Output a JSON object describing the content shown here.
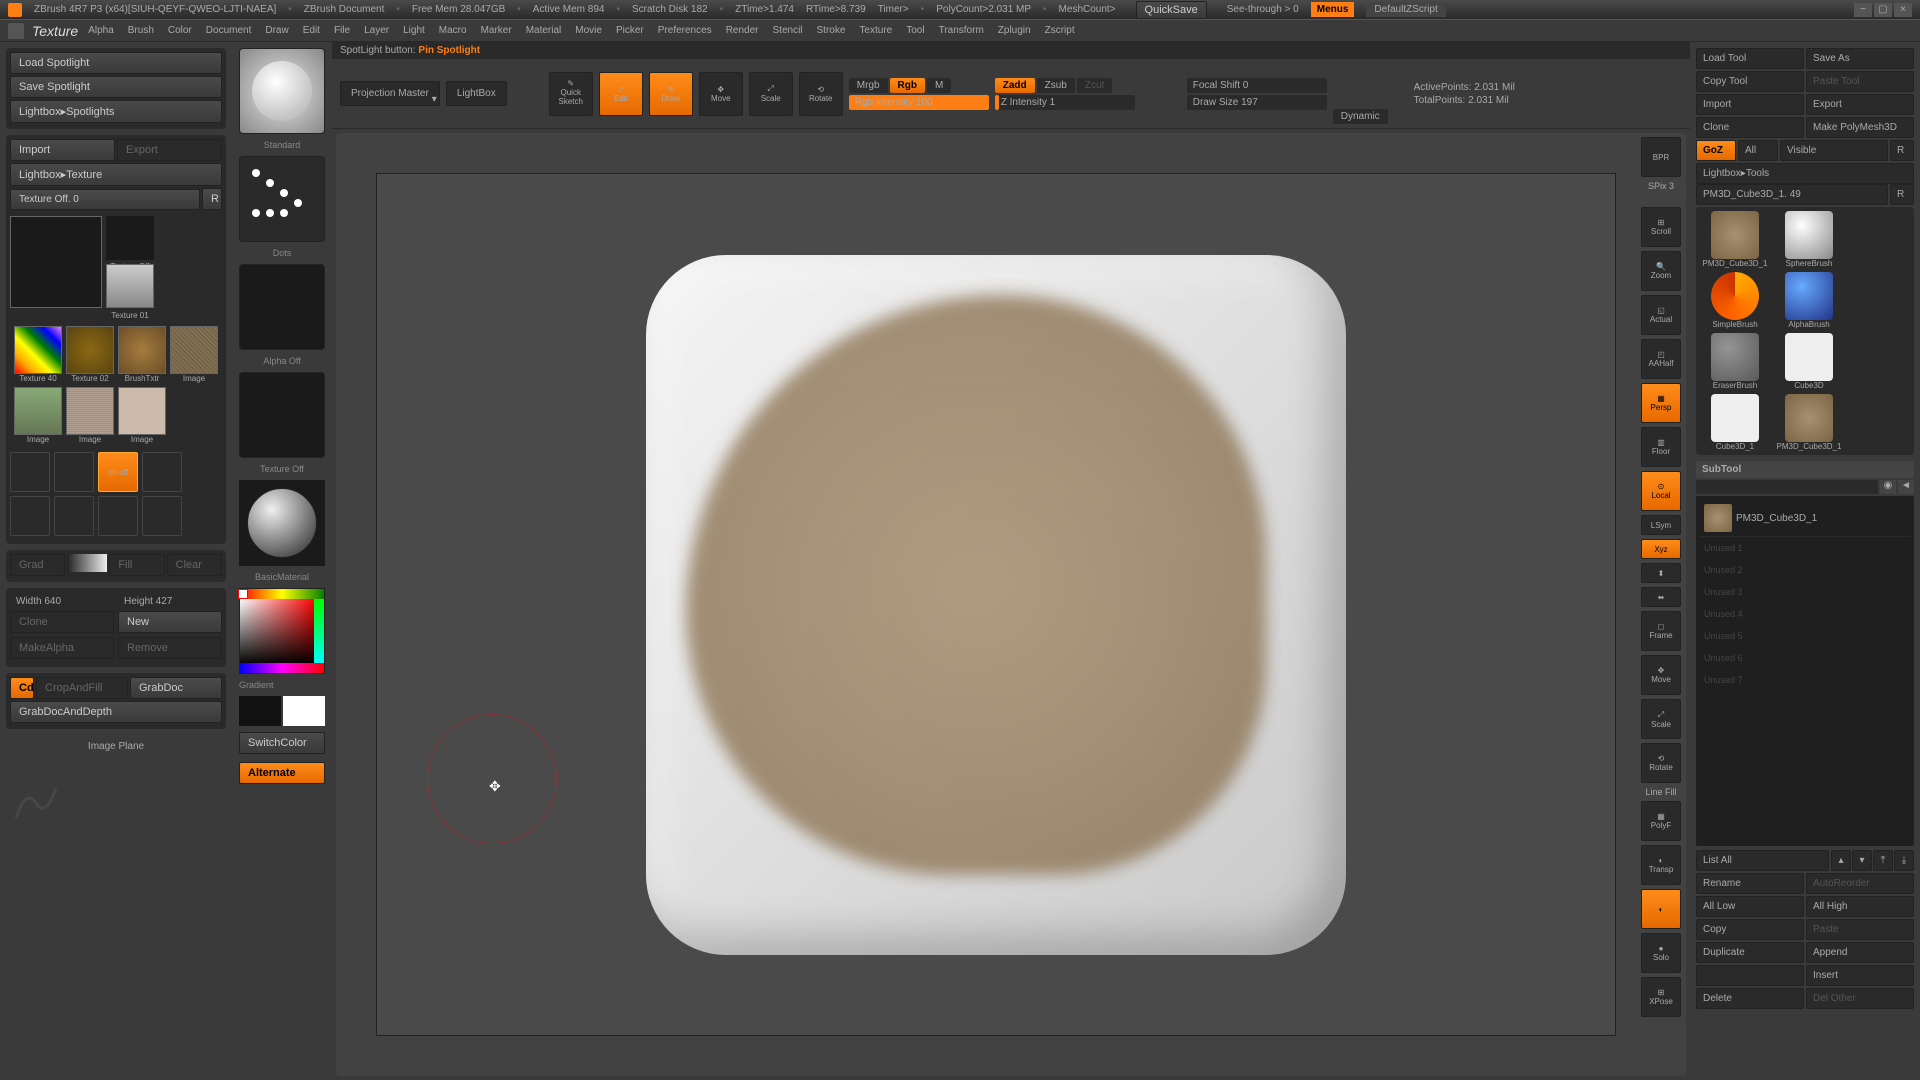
{
  "title_bar": {
    "app": "ZBrush 4R7 P3 (x64)[SIUH-QEYF-QWEO-LJTI-NAEA]",
    "doc": "ZBrush Document",
    "freemem": "Free Mem 28.047GB",
    "activemem": "Active Mem 894",
    "scratch": "Scratch Disk 182",
    "ztime": "ZTime>1.474",
    "rtime": "RTime>8.739",
    "timer": "Timer>",
    "polycount": "PolyCount>2.031 MP",
    "meshcount": "MeshCount>",
    "quicksave": "QuickSave",
    "seethrough": "See-through >  0",
    "menus": "Menus",
    "script": "DefaultZScript"
  },
  "menu": {
    "texture_label": "Texture",
    "items": [
      "Alpha",
      "Brush",
      "Color",
      "Document",
      "Draw",
      "Edit",
      "File",
      "Layer",
      "Light",
      "Macro",
      "Marker",
      "Material",
      "Movie",
      "Picker",
      "Preferences",
      "Render",
      "Stencil",
      "Stroke",
      "Texture",
      "Tool",
      "Transform",
      "Zplugin",
      "Zscript"
    ]
  },
  "caption": {
    "prefix": "SpotLight button:",
    "value": "Pin Spotlight"
  },
  "left": {
    "load_spotlight": "Load Spotlight",
    "save_spotlight": "Save Spotlight",
    "lightbox_spotlights": "Lightbox▸Spotlights",
    "import": "Import",
    "export": "Export",
    "lightbox_texture": "Lightbox▸Texture",
    "texture_off": "Texture Off. 0",
    "r": "R",
    "swatches": {
      "off": "Texture Off",
      "t01": "Texture 01",
      "rainbow": "Texture 40",
      "t02": "Texture 02",
      "brushtxtr": "BrushTxtr",
      "image": "Image",
      "image2": "Image",
      "image3": "Image",
      "image4": "Image"
    },
    "onoff": "on off",
    "grad": "Grad",
    "fill": "Fill",
    "clear": "Clear",
    "width": "Width 640",
    "height": "Height 427",
    "clone": "Clone",
    "new": "New",
    "makealpha": "MakeAlpha",
    "remove": "Remove",
    "cd": "Cd",
    "cropfill": "CropAndFill",
    "grabdoc": "GrabDoc",
    "grabdocdepth": "GrabDocAndDepth",
    "image_plane": "Image Plane"
  },
  "tool_col": {
    "standard": "Standard",
    "dots": "Dots",
    "alpha_off": "Alpha Off",
    "texture_off": "Texture Off",
    "basicmat": "BasicMaterial",
    "gradient": "Gradient",
    "switchcolor": "SwitchColor",
    "alternate": "Alternate"
  },
  "toolbar": {
    "projection": "Projection Master",
    "lightbox": "LightBox",
    "quicksketch": "Quick Sketch",
    "edit": "Edit",
    "draw": "Draw",
    "move": "Move",
    "scale": "Scale",
    "rotate": "Rotate",
    "mrgb": "Mrgb",
    "rgb": "Rgb",
    "m": "M",
    "rgb_intensity": "Rgb Intensity 100",
    "zadd": "Zadd",
    "zsub": "Zsub",
    "zcut": "Zcut",
    "z_intensity": "Z Intensity 1",
    "focal": "Focal Shift 0",
    "drawsize": "Draw Size 197",
    "dynamic": "Dynamic",
    "activepoints": "ActivePoints: 2.031 Mil",
    "totalpoints": "TotalPoints: 2.031 Mil"
  },
  "right_icons": [
    "BPR",
    "SPix 3",
    "Scroll",
    "Zoom",
    "Actual",
    "AAHalf",
    "Persp",
    "Floor",
    "Local",
    "LSym",
    "Xyz",
    "",
    "",
    "Frame",
    "Move",
    "Scale",
    "Rotate",
    "Line Fill",
    "PolyF",
    "Transp",
    "Ghost",
    "Solo",
    "XPose"
  ],
  "right": {
    "load_tool": "Load Tool",
    "save_as": "Save As",
    "copy_tool": "Copy Tool",
    "paste_tool": "Paste Tool",
    "import": "Import",
    "export": "Export",
    "clone": "Clone",
    "make_polymesh": "Make PolyMesh3D",
    "goz": "GoZ",
    "all": "All",
    "visible": "Visible",
    "r": "R",
    "lightbox_tools": "Lightbox▸Tools",
    "current_tool": "PM3D_Cube3D_1. 49",
    "tools": {
      "cube": "PM3D_Cube3D_1",
      "sphere": "SphereBrush",
      "simple": "SimpleBrush",
      "alpha": "AlphaBrush",
      "eraser": "EraserBrush",
      "cube1": "Cube3D",
      "cube2": "Cube3D_1",
      "cube3": "PM3D_Cube3D_1"
    },
    "subtool": "SubTool",
    "subtool_item": "PM3D_Cube3D_1",
    "unused": [
      "Unused 1",
      "Unused 2",
      "Unused 3",
      "Unused 4",
      "Unused 5",
      "Unused 6",
      "Unused 7"
    ],
    "list_all": "List All",
    "rename": "Rename",
    "autoreorder": "AutoReorder",
    "all_low": "All Low",
    "all_high": "All High",
    "copy": "Copy",
    "paste": "Paste",
    "duplicate": "Duplicate",
    "append": "Append",
    "insert": "Insert",
    "delete": "Delete",
    "del_other": "Del Other"
  }
}
